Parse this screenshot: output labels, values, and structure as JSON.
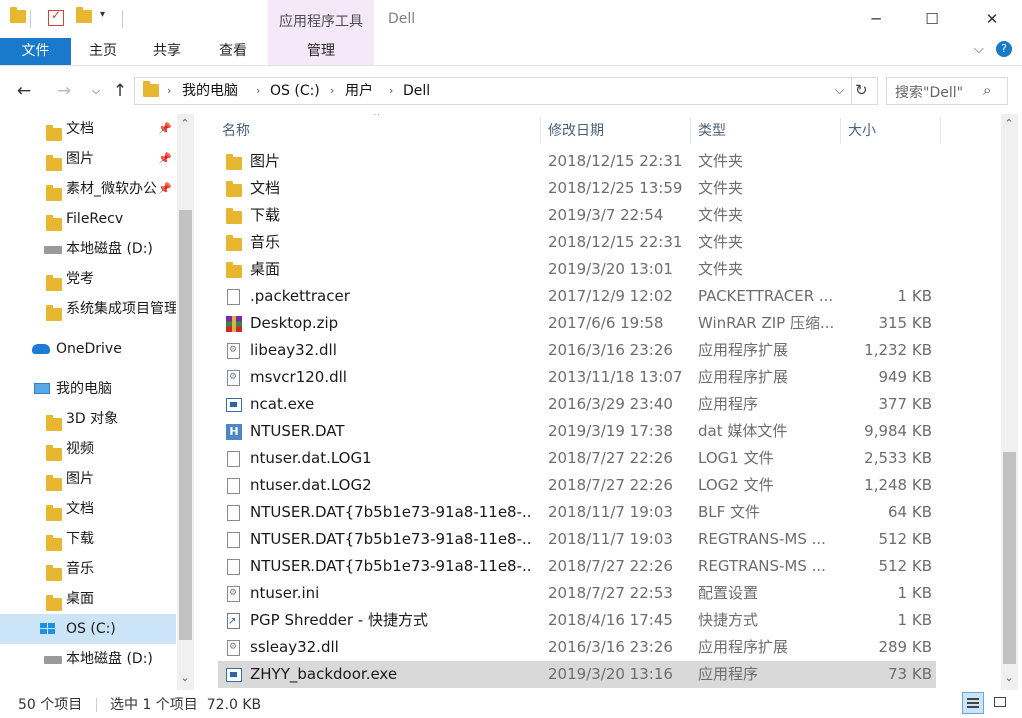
{
  "window": {
    "title": "Dell",
    "context_tab_title": "应用程序工具",
    "controls": {
      "minimize": "─",
      "maximize": "☐",
      "close": "✕"
    }
  },
  "ribbon": {
    "tabs": [
      "文件",
      "主页",
      "共享",
      "查看",
      "管理"
    ],
    "collapse_icon": "chevron-down",
    "help_icon": "?"
  },
  "address": {
    "crumbs": [
      "我的电脑",
      "OS (C:)",
      "用户",
      "Dell"
    ],
    "search_placeholder": "搜索\"Dell\""
  },
  "nav_pane": {
    "items": [
      {
        "label": "文档",
        "icon": "doc-folder-icon",
        "pinned": true
      },
      {
        "label": "图片",
        "icon": "picture-folder-icon",
        "pinned": true
      },
      {
        "label": "素材_微软办公",
        "icon": "folder-icon",
        "pinned": true
      },
      {
        "label": "FileRecv",
        "icon": "folder-icon",
        "pinned": false
      },
      {
        "label": "本地磁盘 (D:)",
        "icon": "drive-icon",
        "pinned": false
      },
      {
        "label": "党考",
        "icon": "folder-icon",
        "pinned": false
      },
      {
        "label": "系统集成项目管理",
        "icon": "folder-icon",
        "pinned": false
      },
      {
        "label": "OneDrive",
        "icon": "cloud-icon",
        "pinned": false
      },
      {
        "label": "我的电脑",
        "icon": "computer-icon",
        "pinned": false
      },
      {
        "label": "3D 对象",
        "icon": "3d-folder-icon",
        "pinned": false
      },
      {
        "label": "视频",
        "icon": "video-folder-icon",
        "pinned": false
      },
      {
        "label": "图片",
        "icon": "picture-folder-icon",
        "pinned": false
      },
      {
        "label": "文档",
        "icon": "doc-folder-icon",
        "pinned": false
      },
      {
        "label": "下载",
        "icon": "download-folder-icon",
        "pinned": false
      },
      {
        "label": "音乐",
        "icon": "music-folder-icon",
        "pinned": false
      },
      {
        "label": "桌面",
        "icon": "desktop-folder-icon",
        "pinned": false
      },
      {
        "label": "OS (C:)",
        "icon": "windows-drive-icon",
        "pinned": false,
        "selected": true
      },
      {
        "label": "本地磁盘 (D:)",
        "icon": "drive-icon",
        "pinned": false
      }
    ]
  },
  "columns": {
    "name": "名称",
    "date": "修改日期",
    "type": "类型",
    "size": "大小"
  },
  "files": [
    {
      "name": "图片",
      "date": "2018/12/15 22:31",
      "type": "文件夹",
      "size": "",
      "icon": "folder"
    },
    {
      "name": "文档",
      "date": "2018/12/25 13:59",
      "type": "文件夹",
      "size": "",
      "icon": "folder"
    },
    {
      "name": "下载",
      "date": "2019/3/7 22:54",
      "type": "文件夹",
      "size": "",
      "icon": "folder"
    },
    {
      "name": "音乐",
      "date": "2018/12/15 22:31",
      "type": "文件夹",
      "size": "",
      "icon": "folder"
    },
    {
      "name": "桌面",
      "date": "2019/3/20 13:01",
      "type": "文件夹",
      "size": "",
      "icon": "folder"
    },
    {
      "name": ".packettracer",
      "date": "2017/12/9 12:02",
      "type": "PACKETTRACER ...",
      "size": "1 KB",
      "icon": "doc"
    },
    {
      "name": "Desktop.zip",
      "date": "2017/6/6 19:58",
      "type": "WinRAR ZIP 压缩...",
      "size": "315 KB",
      "icon": "zip"
    },
    {
      "name": "libeay32.dll",
      "date": "2016/3/16 23:26",
      "type": "应用程序扩展",
      "size": "1,232 KB",
      "icon": "dll"
    },
    {
      "name": "msvcr120.dll",
      "date": "2013/11/18 13:07",
      "type": "应用程序扩展",
      "size": "949 KB",
      "icon": "dll"
    },
    {
      "name": "ncat.exe",
      "date": "2016/3/29 23:40",
      "type": "应用程序",
      "size": "377 KB",
      "icon": "exe"
    },
    {
      "name": "NTUSER.DAT",
      "date": "2019/3/19 17:38",
      "type": "dat 媒体文件",
      "size": "9,984 KB",
      "icon": "dat"
    },
    {
      "name": "ntuser.dat.LOG1",
      "date": "2018/7/27 22:26",
      "type": "LOG1 文件",
      "size": "2,533 KB",
      "icon": "doc"
    },
    {
      "name": "ntuser.dat.LOG2",
      "date": "2018/7/27 22:26",
      "type": "LOG2 文件",
      "size": "1,248 KB",
      "icon": "doc"
    },
    {
      "name": "NTUSER.DAT{7b5b1e73-91a8-11e8-...",
      "date": "2018/11/7 19:03",
      "type": "BLF 文件",
      "size": "64 KB",
      "icon": "doc"
    },
    {
      "name": "NTUSER.DAT{7b5b1e73-91a8-11e8-...",
      "date": "2018/11/7 19:03",
      "type": "REGTRANS-MS ...",
      "size": "512 KB",
      "icon": "doc"
    },
    {
      "name": "NTUSER.DAT{7b5b1e73-91a8-11e8-...",
      "date": "2018/7/27 22:26",
      "type": "REGTRANS-MS ...",
      "size": "512 KB",
      "icon": "doc"
    },
    {
      "name": "ntuser.ini",
      "date": "2018/7/27 22:53",
      "type": "配置设置",
      "size": "1 KB",
      "icon": "ini"
    },
    {
      "name": "PGP Shredder - 快捷方式",
      "date": "2018/4/16 17:45",
      "type": "快捷方式",
      "size": "1 KB",
      "icon": "lnk"
    },
    {
      "name": "ssleay32.dll",
      "date": "2016/3/16 23:26",
      "type": "应用程序扩展",
      "size": "289 KB",
      "icon": "dll"
    },
    {
      "name": "ZHYY_backdoor.exe",
      "date": "2019/3/20 13:16",
      "type": "应用程序",
      "size": "73 KB",
      "icon": "exe",
      "selected": true
    }
  ],
  "status": {
    "item_count": "50 个项目",
    "selection": "选中 1 个项目  72.0 KB"
  },
  "colors": {
    "file_tab": "#1979ca",
    "context_tab": "#f4e8f9",
    "nav_selected": "#cce4f7",
    "row_selected": "#d9d9d9"
  }
}
